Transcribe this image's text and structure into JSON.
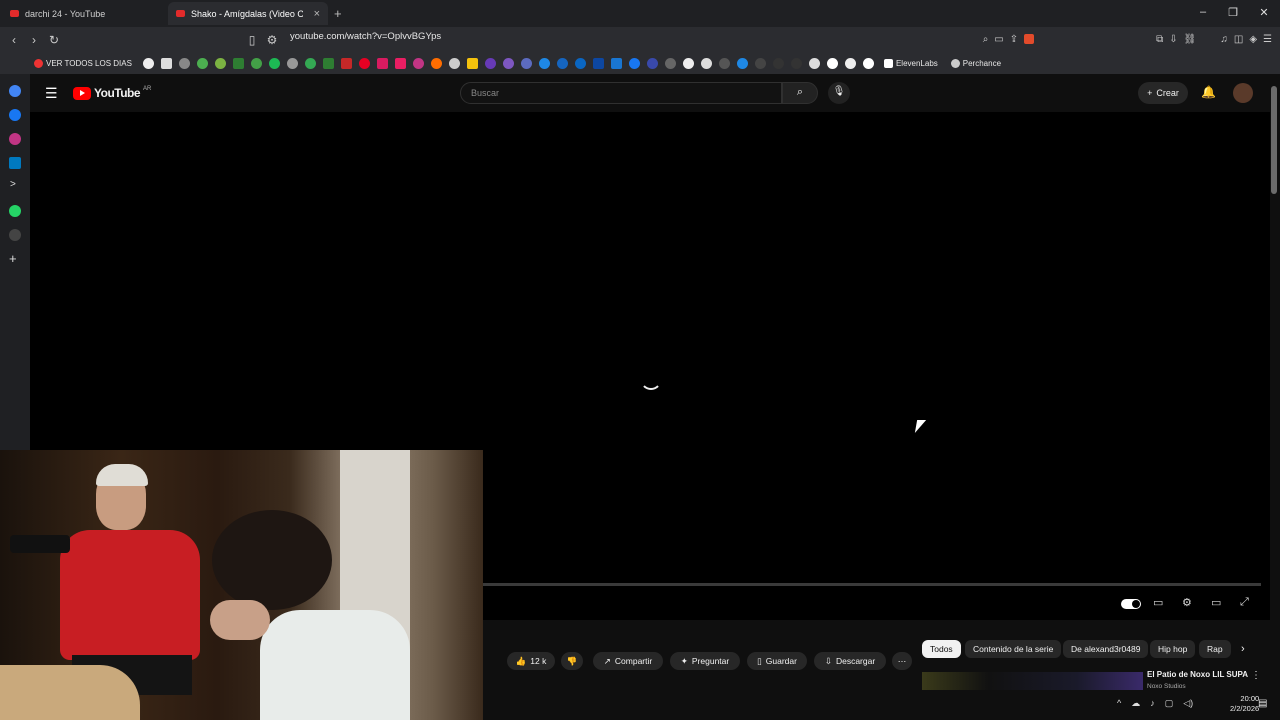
{
  "browser": {
    "tabs": [
      {
        "title": "darchi 24 - YouTube"
      },
      {
        "title": "Shako - Amígdalas (Video Oficial"
      }
    ],
    "url": "youtube.com/watch?v=OplvvBGYps",
    "bookmarks": [
      "VER TODOS LOS DIAS",
      "ElevenLabs",
      "Perchance"
    ]
  },
  "youtube": {
    "logo_text": "YouTube",
    "logo_region": "AR",
    "search_placeholder": "Buscar",
    "create_label": "Crear"
  },
  "actions": {
    "likes": "12 k",
    "share": "Compartir",
    "ask": "Preguntar",
    "save": "Guardar",
    "download": "Descargar"
  },
  "chips": [
    "Todos",
    "Contenido de la serie",
    "De alexand3r0489",
    "Hip hop",
    "Rap"
  ],
  "recommended": {
    "title": "El Patio de Noxo LIL SUPA",
    "channel": "Noxo Studios"
  },
  "clock": {
    "time": "20:00",
    "date": "2/2/2026"
  },
  "colors": {
    "yt_red": "#ff0000",
    "bg": "#0f0f0f",
    "browser_chrome": "#2b2c30"
  }
}
